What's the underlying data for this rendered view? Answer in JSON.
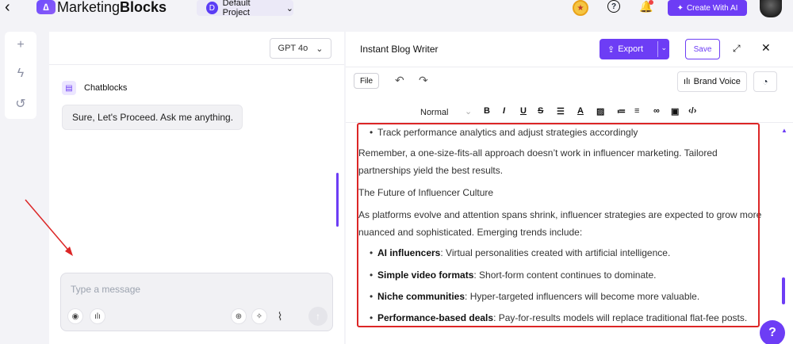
{
  "topbar": {
    "back_icon": "chevron-left-icon",
    "brand_prefix": "Marketing",
    "brand_suffix": "Blocks",
    "project_initial": "D",
    "project_name": "Default Project",
    "create_ai_label": "Create With AI"
  },
  "chat": {
    "model": "GPT 4o",
    "chatblocks_label": "Chatblocks",
    "welcome": "Sure, Let's Proceed. Ask me anything.",
    "placeholder": "Type a message"
  },
  "editor": {
    "title": "Instant Blog Writer",
    "export_label": "Export",
    "save_label": "Save",
    "file_label": "File",
    "brand_voice_label": "Brand Voice",
    "format_style": "Normal",
    "content": {
      "bullet_top": "Track performance analytics and adjust strategies accordingly",
      "para1_line1": "Remember, a one-size-fits-all approach doesn’t work in influencer marketing. Tailored",
      "para1_line2": "partnerships yield the best results.",
      "heading": "The Future of Influencer Culture",
      "para2_line1": "As platforms evolve and attention spans shrink, influencer strategies are expected to grow more",
      "para2_line2": "nuanced and sophisticated. Emerging trends include:",
      "trends": [
        {
          "title": "AI influencers",
          "text": ": Virtual personalities created with artificial intelligence."
        },
        {
          "title": "Simple video formats",
          "text": ": Short-form content continues to dominate."
        },
        {
          "title": "Niche communities",
          "text": ": Hyper-targeted influencers will become more valuable."
        },
        {
          "title": "Performance-based deals",
          "text": ": Pay-for-results models will replace traditional flat-fee posts."
        }
      ]
    }
  },
  "colors": {
    "accent": "#6d3df5",
    "highlight": "#dc2626"
  }
}
